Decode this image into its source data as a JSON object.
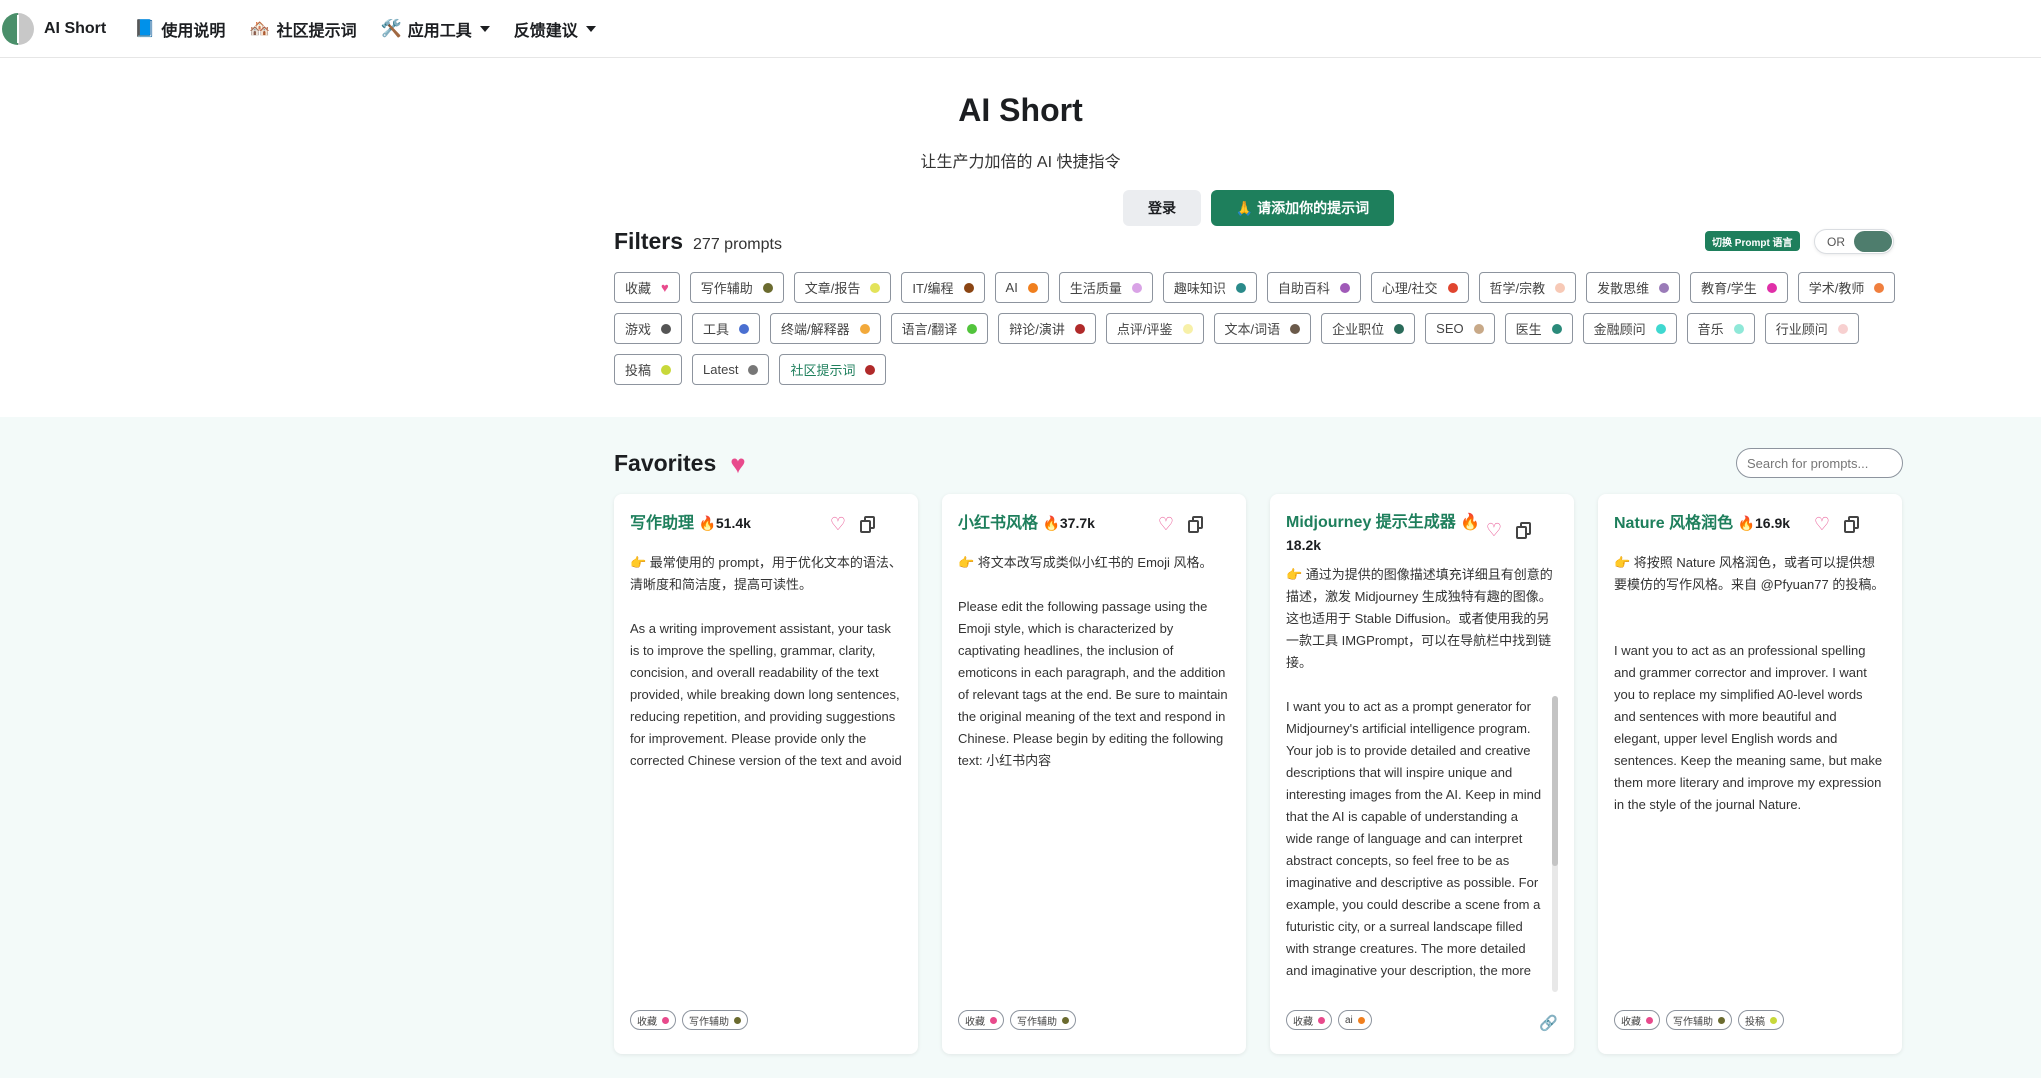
{
  "nav": {
    "brand": "AI Short",
    "items": [
      {
        "emoji": "📘",
        "label": "使用说明",
        "caret": false
      },
      {
        "emoji": "🏘️",
        "label": "社区提示词",
        "caret": false
      },
      {
        "emoji": "🛠️",
        "label": "应用工具",
        "caret": true
      },
      {
        "emoji": "",
        "label": "反馈建议",
        "caret": true
      }
    ]
  },
  "hero": {
    "title": "AI Short",
    "subtitle": "让生产力加倍的 AI 快捷指令",
    "login_label": "登录",
    "add_label": "🙏 请添加你的提示词"
  },
  "filters": {
    "title": "Filters",
    "count": "277 prompts",
    "lang_badge": "切换 Prompt 语言",
    "toggle_label": "OR",
    "tags": [
      {
        "label": "收藏",
        "color": "#e84a8c",
        "heart": true
      },
      {
        "label": "写作辅助",
        "color": "#6b6b2f"
      },
      {
        "label": "文章/报告",
        "color": "#e3e35a"
      },
      {
        "label": "IT/编程",
        "color": "#8b4513"
      },
      {
        "label": "AI",
        "color": "#f07f1e"
      },
      {
        "label": "生活质量",
        "color": "#d9a3e6"
      },
      {
        "label": "趣味知识",
        "color": "#2a8a8a"
      },
      {
        "label": "自助百科",
        "color": "#a05ab8"
      },
      {
        "label": "心理/社交",
        "color": "#e0452f"
      },
      {
        "label": "哲学/宗教",
        "color": "#f7c9b6"
      },
      {
        "label": "发散思维",
        "color": "#9a7bb8"
      },
      {
        "label": "教育/学生",
        "color": "#e02fa8"
      },
      {
        "label": "学术/教师",
        "color": "#f07f3e"
      },
      {
        "label": "游戏",
        "color": "#555555"
      },
      {
        "label": "工具",
        "color": "#4a6fd1"
      },
      {
        "label": "终端/解释器",
        "color": "#f2a93b"
      },
      {
        "label": "语言/翻译",
        "color": "#52c43c"
      },
      {
        "label": "辩论/演讲",
        "color": "#b02a2a"
      },
      {
        "label": "点评/评鉴",
        "color": "#f7f0a8"
      },
      {
        "label": "文本/词语",
        "color": "#6b5a4a"
      },
      {
        "label": "企业职位",
        "color": "#2a6b5a"
      },
      {
        "label": "SEO",
        "color": "#c8a988"
      },
      {
        "label": "医生",
        "color": "#2a8a7a"
      },
      {
        "label": "金融顾问",
        "color": "#3fd8d0"
      },
      {
        "label": "音乐",
        "color": "#8fe8d8"
      },
      {
        "label": "行业顾问",
        "color": "#f7d0d0"
      },
      {
        "label": "投稿",
        "color": "#c8d83a"
      },
      {
        "label": "Latest",
        "color": "#777777"
      },
      {
        "label": "社区提示词",
        "color": "#b02a2a",
        "green": true
      }
    ]
  },
  "favorites": {
    "title": "Favorites",
    "search_placeholder": "Search for prompts...",
    "cards": [
      {
        "title": "写作助理",
        "hot": "🔥51.4k",
        "desc": "👉 最常使用的 prompt，用于优化文本的语法、清晰度和简洁度，提高可读性。",
        "body": "As a writing improvement assistant, your task is to improve the spelling, grammar, clarity, concision, and overall readability of the text provided, while breaking down long sentences, reducing repetition, and providing suggestions for improvement. Please provide only the corrected Chinese version of the text and avoid including explanations. Please begin by editing the following text: [文章内容]",
        "tags": [
          {
            "label": "收藏",
            "color": "#e84a8c"
          },
          {
            "label": "写作辅助",
            "color": "#6b6b2f"
          }
        ]
      },
      {
        "title": "小红书风格",
        "hot": "🔥37.7k",
        "desc": "👉 将文本改写成类似小红书的 Emoji 风格。",
        "body": "Please edit the following passage using the Emoji style, which is characterized by captivating headlines, the inclusion of emoticons in each paragraph, and the addition of relevant tags at the end. Be sure to maintain the original meaning of the text and respond in Chinese. Please begin by editing the following text: 小红书内容",
        "tags": [
          {
            "label": "收藏",
            "color": "#e84a8c"
          },
          {
            "label": "写作辅助",
            "color": "#6b6b2f"
          }
        ]
      },
      {
        "title": "Midjourney 提示生成器",
        "hot": "🔥",
        "hot2": "18.2k",
        "desc": "👉 通过为提供的图像描述填充详细且有创意的描述，激发 Midjourney 生成独特有趣的图像。这也适用于 Stable Diffusion。或者使用我的另一款工具 IMGPrompt，可以在导航栏中找到链接。",
        "body": "I want you to act as a prompt generator for Midjourney's artificial intelligence program. Your job is to provide detailed and creative descriptions that will inspire unique and interesting images from the AI. Keep in mind that the AI is capable of understanding a wide range of language and can interpret abstract concepts, so feel free to be as imaginative and descriptive as possible. For example, you could describe a scene from a futuristic city, or a surreal landscape filled with strange creatures. The more detailed and imaginative your description, the more",
        "tags": [
          {
            "label": "收藏",
            "color": "#e84a8c"
          },
          {
            "label": "ai",
            "color": "#f07f1e"
          }
        ]
      },
      {
        "title": "Nature 风格润色",
        "hot": "🔥16.9k",
        "desc": "👉 将按照 Nature 风格润色，或者可以提供想要模仿的写作风格。来自 @Pfyuan77 的投稿。",
        "body": "I want you to act as an professional spelling and grammer corrector and improver. I want you to replace my simplified A0-level words and sentences with more beautiful and elegant, upper level English words and sentences. Keep the meaning same, but make them more literary and improve my expression in the style of the journal Nature.",
        "tags": [
          {
            "label": "收藏",
            "color": "#e84a8c"
          },
          {
            "label": "写作辅助",
            "color": "#6b6b2f"
          },
          {
            "label": "投稿",
            "color": "#c8d83a"
          }
        ]
      }
    ]
  }
}
